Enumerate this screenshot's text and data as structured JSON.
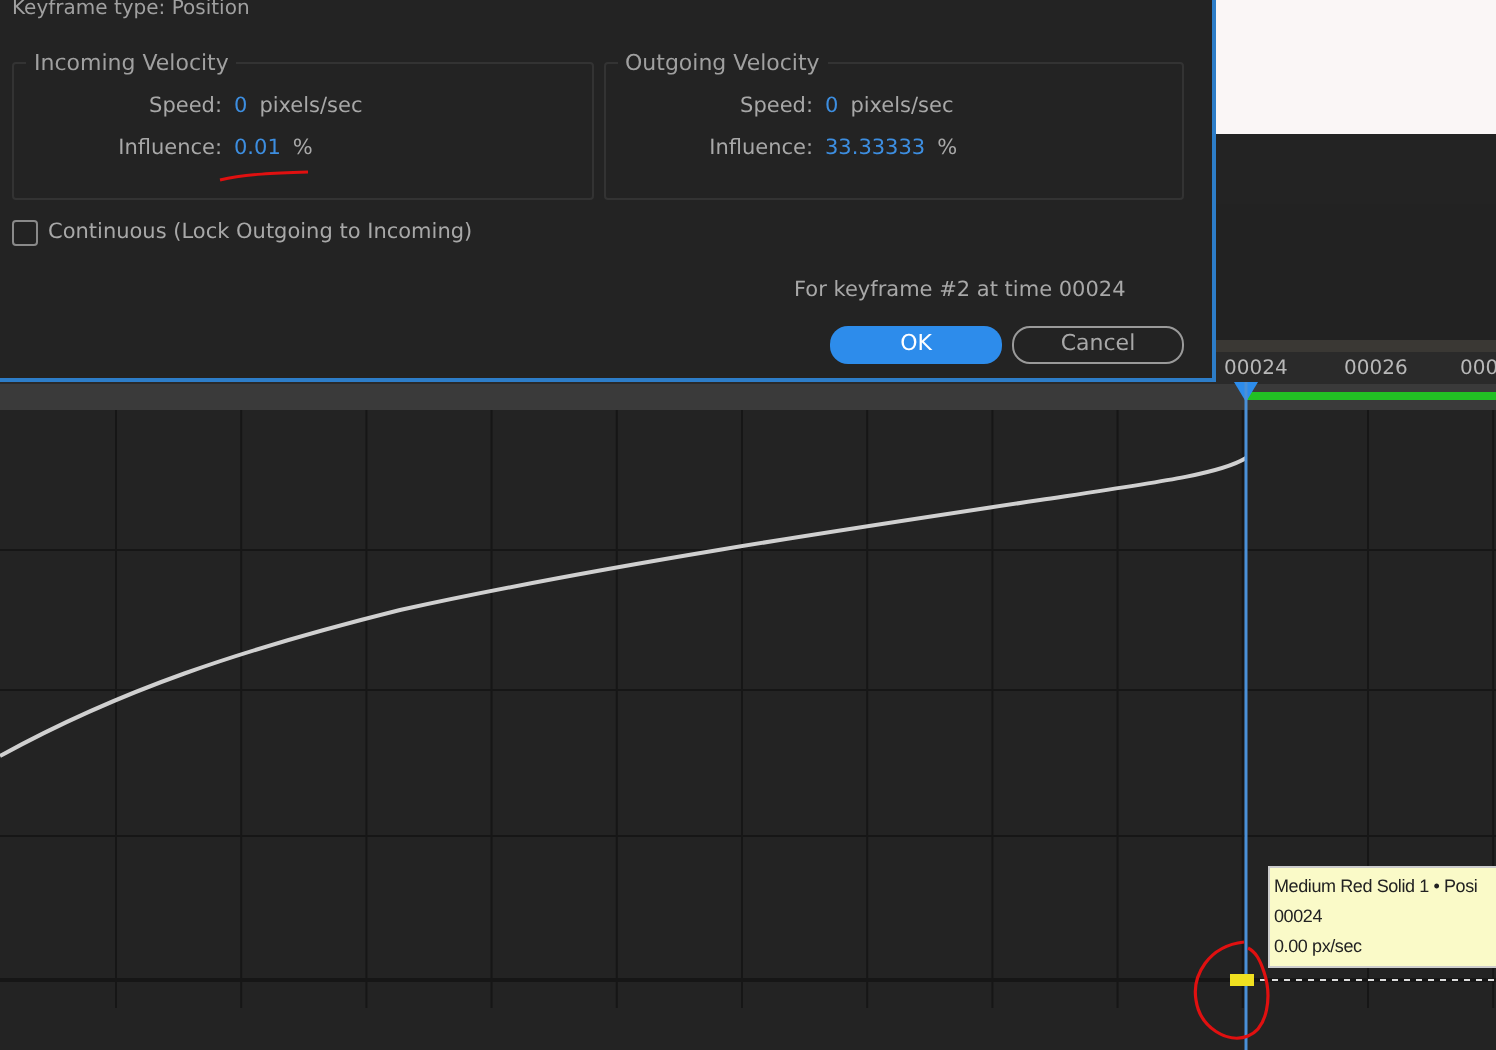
{
  "dialog": {
    "title": "Keyframe type: Position",
    "sections": [
      {
        "heading": "Incoming Velocity",
        "speed_label": "Speed:",
        "speed_value": "0",
        "speed_unit": "pixels/sec",
        "influence_label": "Influence:",
        "influence_value": "0.01",
        "influence_unit": "%",
        "annotated": true
      },
      {
        "heading": "Outgoing Velocity",
        "speed_label": "Speed:",
        "speed_value": "0",
        "speed_unit": "pixels/sec",
        "influence_label": "Influence:",
        "influence_value": "33.33333",
        "influence_unit": "%",
        "annotated": false
      }
    ],
    "continuous": {
      "label": "Continuous (Lock Outgoing to Incoming)",
      "checked": false
    },
    "keyframe_info": "For keyframe #2 at time 00024",
    "buttons": [
      {
        "label": "OK",
        "kind": "primary"
      },
      {
        "label": "Cancel",
        "kind": "secondary"
      }
    ]
  },
  "timeline": {
    "ruler_labels": [
      "00024",
      "00026",
      "000"
    ]
  },
  "tooltip": {
    "lines": [
      "Medium Red Solid 1 • Posi",
      "00024",
      "0.00 px/sec"
    ]
  }
}
